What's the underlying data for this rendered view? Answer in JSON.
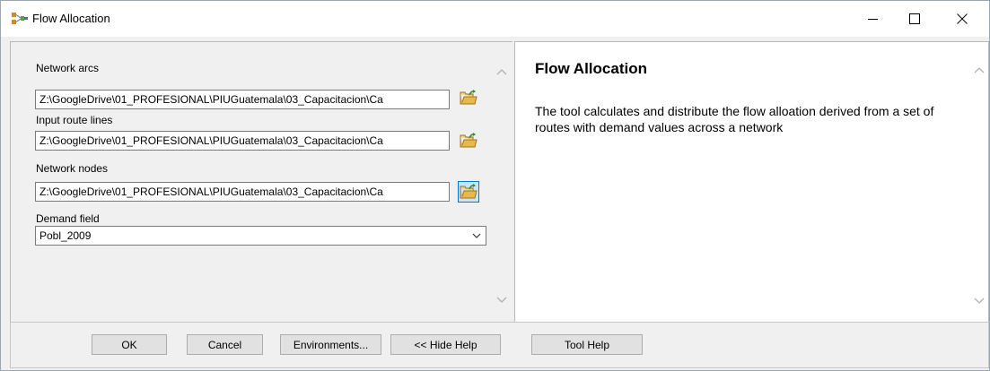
{
  "window": {
    "title": "Flow Allocation",
    "icon": "model-tool-icon",
    "controls": [
      "minimize-icon",
      "maximize-icon",
      "close-icon"
    ]
  },
  "form": {
    "network_arcs": {
      "label": "Network arcs",
      "value": "Z:\\GoogleDrive\\01_PROFESIONAL\\PIUGuatemala\\03_Capacitacion\\Ca"
    },
    "input_route_lines": {
      "label": "Input route lines",
      "value": "Z:\\GoogleDrive\\01_PROFESIONAL\\PIUGuatemala\\03_Capacitacion\\Ca"
    },
    "network_nodes": {
      "label": "Network nodes",
      "value": "Z:\\GoogleDrive\\01_PROFESIONAL\\PIUGuatemala\\03_Capacitacion\\Ca"
    },
    "demand_field": {
      "label": "Demand field",
      "value": "Pobl_2009"
    }
  },
  "help": {
    "title": "Flow Allocation",
    "body": "The tool calculates and distribute the flow alloation derived from a set of routes with demand values across a network"
  },
  "buttons": {
    "ok": "OK",
    "cancel": "Cancel",
    "environments": "Environments...",
    "hide_help": "<< Hide Help",
    "tool_help": "Tool Help"
  },
  "colors": {
    "focus_border": "#0078d7",
    "folder_yellow": "#e8b84a",
    "folder_arrow": "#2f8f3a"
  }
}
